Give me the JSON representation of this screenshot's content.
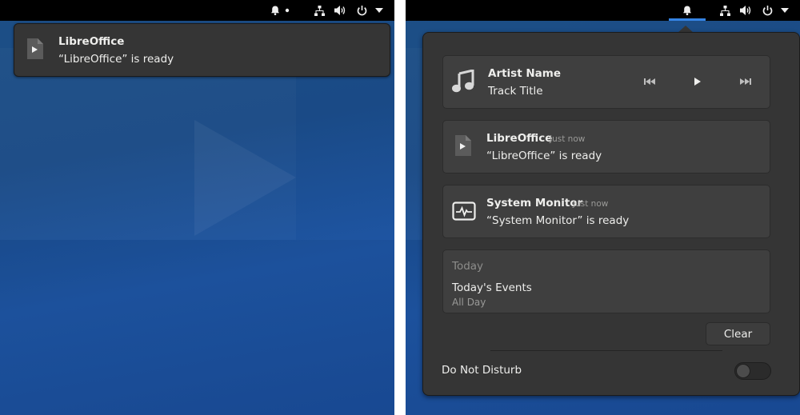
{
  "left": {
    "panel_icons": [
      "bell-icon",
      "unread-dot",
      "network-icon",
      "volume-icon",
      "power-icon",
      "menu-arrow-icon"
    ],
    "banner": {
      "app_icon": "document-play-icon",
      "title": "LibreOffice",
      "body": "“LibreOffice” is ready"
    }
  },
  "right": {
    "panel_icons": [
      "bell-icon",
      "network-icon",
      "volume-icon",
      "power-icon",
      "menu-arrow-icon"
    ],
    "accent_color": "#3584e4",
    "media": {
      "icon": "music-note-icon",
      "artist": "Artist Name",
      "track": "Track Title",
      "controls": [
        "previous-icon",
        "play-icon",
        "next-icon"
      ]
    },
    "notifications": [
      {
        "icon": "document-play-icon",
        "title": "LibreOffice",
        "time": "Just now",
        "body": "“LibreOffice” is ready"
      },
      {
        "icon": "system-monitor-icon",
        "title": "System Monitor",
        "time": "Just now",
        "body": "“System Monitor” is ready"
      }
    ],
    "events": {
      "header": "Today",
      "title": "Today's Events",
      "subtitle": "All Day"
    },
    "clear_label": "Clear",
    "dnd_label": "Do Not Disturb",
    "dnd_enabled": false
  }
}
